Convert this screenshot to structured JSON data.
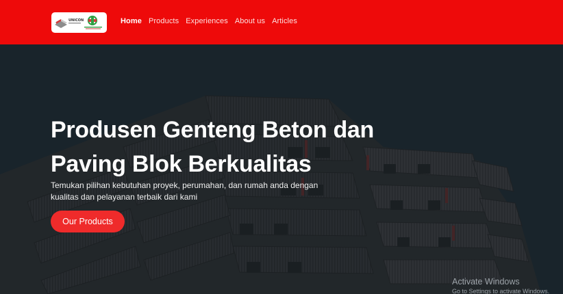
{
  "navbar": {
    "logo": {
      "brand_primary": "UNICON",
      "brand_secondary": "",
      "colors": {
        "accent": "#2ea043",
        "mark": "#d33b3b"
      }
    },
    "links": [
      {
        "label": "Home",
        "active": true
      },
      {
        "label": "Products",
        "active": false
      },
      {
        "label": "Experiences",
        "active": false
      },
      {
        "label": "About us",
        "active": false
      },
      {
        "label": "Articles",
        "active": false
      }
    ]
  },
  "hero": {
    "title_line1": "Produsen Genteng Beton dan",
    "title_line2": "Paving Blok Berkualitas",
    "subtitle_line1": "Temukan pilihan kebutuhan proyek,  perumahan, dan rumah anda dengan",
    "subtitle_line2": "kualitas dan pelayanan  terbaik dari kami",
    "cta_label": "Our Products"
  },
  "watermark": {
    "title": "Activate Windows",
    "subtitle": "Go to Settings to activate Windows."
  },
  "colors": {
    "navbar_bg": "#ee0a0a",
    "cta_bg": "#ef2b2b",
    "hero_overlay": "#1f2a33"
  }
}
